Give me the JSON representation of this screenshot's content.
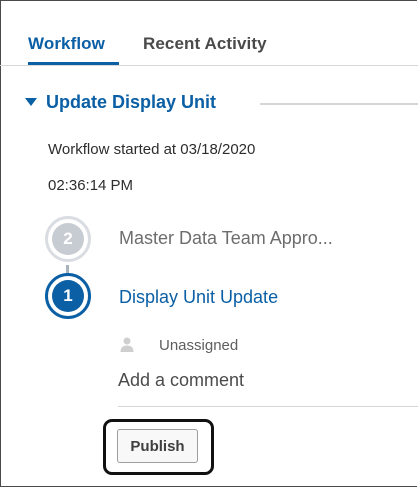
{
  "tabs": [
    {
      "label": "Workflow",
      "active": true
    },
    {
      "label": "Recent Activity",
      "active": false
    }
  ],
  "section": {
    "title": "Update Display Unit",
    "expanded": true,
    "caret_icon": "caret-down-icon"
  },
  "workflow": {
    "started_line1": "Workflow started at 03/18/2020",
    "started_line2": "02:36:14 PM"
  },
  "steps": [
    {
      "number": "2",
      "label": "Master Data Team Appro...",
      "state": "pending"
    },
    {
      "number": "1",
      "label": "Display Unit Update",
      "state": "current"
    }
  ],
  "assignee": {
    "icon": "person-icon",
    "text": "Unassigned"
  },
  "comment": {
    "placeholder": "Add a comment"
  },
  "actions": {
    "publish_label": "Publish"
  },
  "colors": {
    "accent": "#0b5fa5",
    "pending_circle": "#c7ccd2",
    "text": "#333333",
    "highlight_border": "#111111"
  }
}
